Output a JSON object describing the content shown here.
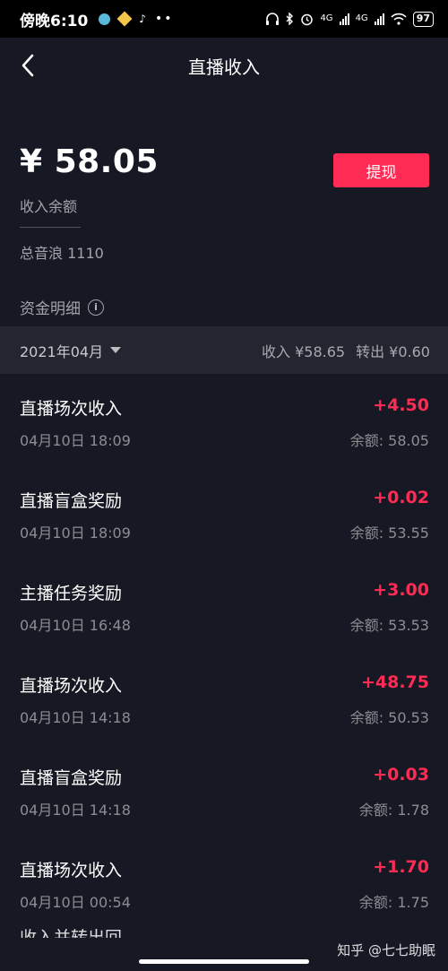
{
  "status_bar": {
    "time": "傍晚6:10",
    "battery": "97",
    "network_1": "4G",
    "network_2": "4G"
  },
  "nav": {
    "title": "直播收入"
  },
  "balance": {
    "amount": "¥ 58.05",
    "label": "收入余额",
    "yinlang": "总音浪 1110",
    "withdraw_label": "提现"
  },
  "details": {
    "heading": "资金明细",
    "month": "2021年04月",
    "income": "收入 ¥58.65",
    "outgo": "转出 ¥0.60"
  },
  "transactions": [
    {
      "title": "直播场次收入",
      "time": "04月10日 18:09",
      "amount": "+4.50",
      "balance": "余额: 58.05"
    },
    {
      "title": "直播盲盒奖励",
      "time": "04月10日 18:09",
      "amount": "+0.02",
      "balance": "余额: 53.55"
    },
    {
      "title": "主播任务奖励",
      "time": "04月10日 16:48",
      "amount": "+3.00",
      "balance": "余额: 53.53"
    },
    {
      "title": "直播场次收入",
      "time": "04月10日 14:18",
      "amount": "+48.75",
      "balance": "余额: 50.53"
    },
    {
      "title": "直播盲盒奖励",
      "time": "04月10日 14:18",
      "amount": "+0.03",
      "balance": "余额: 1.78"
    },
    {
      "title": "直播场次收入",
      "time": "04月10日 00:54",
      "amount": "+1.70",
      "balance": "余额: 1.75"
    }
  ],
  "partial_row_title": "收入并转出回",
  "watermark": "知乎 @七七助眠",
  "colors": {
    "accent": "#fe2c55",
    "background": "#161823",
    "month_bar": "#232530"
  },
  "icons": {
    "back": "chevron-left-icon",
    "info": "info-icon",
    "dropdown": "caret-down-icon"
  }
}
